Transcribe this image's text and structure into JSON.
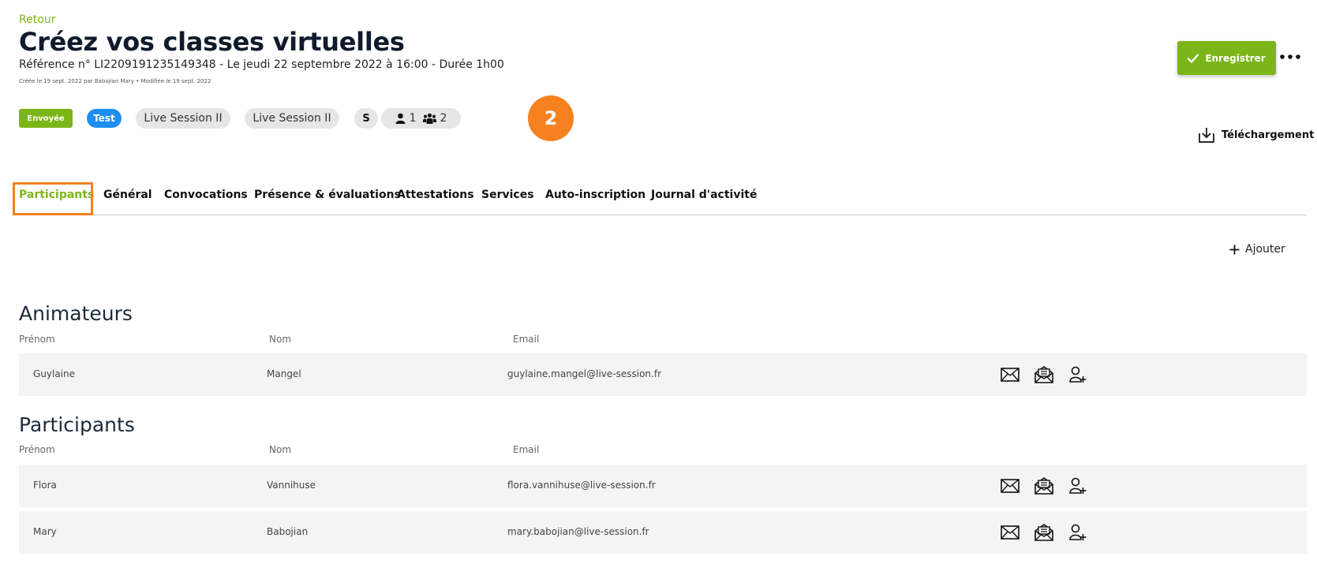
{
  "header": {
    "back_label": "Retour",
    "title": "Créez vos classes virtuelles",
    "subtitle": "Référence n° LI220919123514934​8 - Le jeudi 22 septembre 2022 à 16:00 - Durée 1h00",
    "meta": "Créée le 19 sept. 2022 par Babojian Mary • Modifiée le 19 sept. 2022"
  },
  "actions": {
    "save_label": "Enregistrer",
    "more_label": "•••",
    "download_label": "Téléchargement",
    "add_label": "Ajouter"
  },
  "badges": {
    "status": "Envoyée",
    "test": "Test",
    "room_1": "Live Session II",
    "room_2": "Live Session II",
    "initial": "S",
    "animators_count": "1",
    "participants_count": "2"
  },
  "step_marker": "2",
  "tabs": [
    {
      "label": "Participants",
      "active": true
    },
    {
      "label": "Général"
    },
    {
      "label": "Convocations"
    },
    {
      "label": "Présence & évaluations"
    },
    {
      "label": "Attestations"
    },
    {
      "label": "Services"
    },
    {
      "label": "Auto-inscription"
    },
    {
      "label": "Journal d'activité"
    }
  ],
  "columns": {
    "first_name": "Prénom",
    "last_name": "Nom",
    "email": "Email"
  },
  "animators": {
    "title": "Animateurs",
    "rows": [
      {
        "first_name": "Guylaine",
        "last_name": "Mangel",
        "email": "guylaine.mangel@live-session.fr"
      }
    ]
  },
  "participants": {
    "title": "Participants",
    "rows": [
      {
        "first_name": "Flora",
        "last_name": "Vannihuse",
        "email": "flora.vannihuse@live-session.fr"
      },
      {
        "first_name": "Mary",
        "last_name": "Babojian",
        "email": "mary.babojian@live-session.fr"
      }
    ]
  },
  "icons": {
    "save": "check-icon",
    "more": "more-icon",
    "download": "download-icon",
    "add": "plus-icon",
    "row_actions": [
      "mail-icon",
      "open-mail-icon",
      "add-user-icon"
    ],
    "counts": [
      "person-icon",
      "group-icon"
    ]
  },
  "colors": {
    "accent": "#7cb518",
    "test_badge": "#1f8ef1",
    "highlight": "#f5821f",
    "title": "#0f1a2c"
  }
}
